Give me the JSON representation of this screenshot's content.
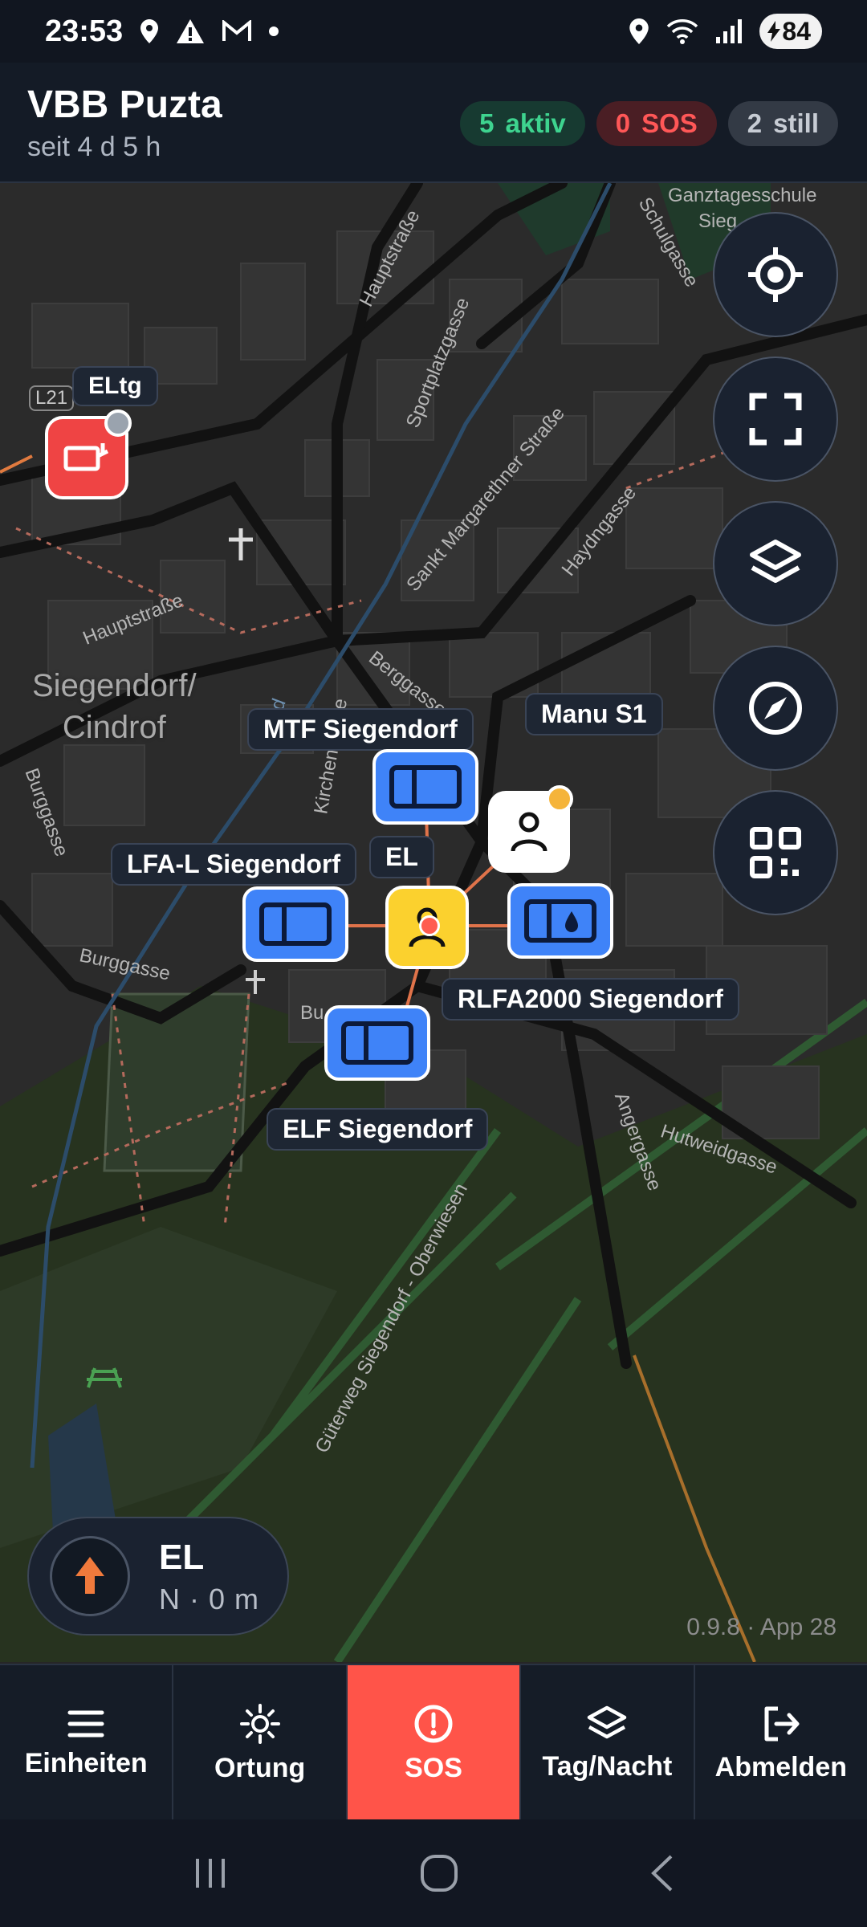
{
  "statusbar": {
    "time": "23:53",
    "battery": "84"
  },
  "header": {
    "title": "VBB Puzta",
    "subtitle": "seit 4 d 5 h",
    "badges": {
      "active": {
        "count": "5",
        "label": "aktiv"
      },
      "sos": {
        "count": "0",
        "label": "SOS"
      },
      "still": {
        "count": "2",
        "label": "still"
      }
    }
  },
  "map": {
    "streets": {
      "hauptstrasse_top": "Hauptstraße",
      "sportplatzgasse": "Sportplatzgasse",
      "margarethner": "Sankt Margarethner Straße",
      "haydngasse": "Haydngasse",
      "hauptstrasse_mid": "Hauptstraße",
      "berggasse": "Berggasse",
      "burggasse": "Burggasse",
      "burggasse_left": "Burggasse",
      "hutweidgasse": "Hutweidgasse",
      "angergasse": "Angergasse",
      "gueterweg": "Güterweg Siegendorf - Oberwiesen",
      "schulgasse": "Schulgasse",
      "school": "Ganztagesschule",
      "school2": "Sieg",
      "road": "L21",
      "kirchengasse": "Kirchengasse",
      "nodbach": "Nod",
      "bu": "Bu"
    },
    "place": {
      "line1": "Siegendorf/",
      "line2": "Cindrof"
    },
    "units": {
      "eltg": "ELtg",
      "mtf": "MTF Siegendorf",
      "manu": "Manu S1",
      "el": "EL",
      "lfa": "LFA-L Siegendorf",
      "rlfa": "RLFA2000 Siegendorf",
      "elf": "ELF Siegendorf"
    }
  },
  "location": {
    "name": "EL",
    "info": "N · 0 m"
  },
  "version": "0.9.8 · App 28",
  "nav": {
    "units": "Einheiten",
    "tracking": "Ortung",
    "sos": "SOS",
    "daynight": "Tag/Nacht",
    "logout": "Abmelden"
  },
  "colors": {
    "accent_blue": "#3f83f8",
    "sos_red": "#ff5449",
    "active_green": "#3ed38f",
    "person_yellow": "#fbd12e",
    "header_bg": "#141b26"
  },
  "icons": {
    "fab": [
      "crosshair-icon",
      "fullscreen-icon",
      "layers-icon",
      "compass-icon",
      "qr-code-icon"
    ],
    "nav": [
      "menu-icon",
      "brightness-icon",
      "alert-circle-icon",
      "layers-icon",
      "logout-icon"
    ]
  }
}
